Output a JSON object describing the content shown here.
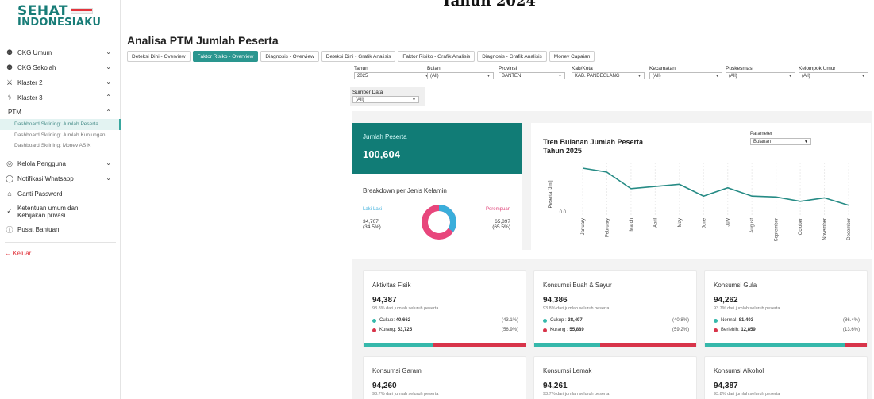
{
  "top_title": "Tahun 2024",
  "logo": {
    "line1": "SEHAT",
    "line2": "INDONESIAKU"
  },
  "sidebar": {
    "items": [
      {
        "label": "CKG Umum",
        "icon": "users-icon",
        "glyph": "⚉"
      },
      {
        "label": "CKG Sekolah",
        "icon": "users-icon",
        "glyph": "⚉"
      },
      {
        "label": "Klaster 2",
        "icon": "family-icon",
        "glyph": "⚔"
      },
      {
        "label": "Klaster 3",
        "icon": "medical-icon",
        "glyph": "⚕"
      }
    ],
    "ptm_label": "PTM",
    "sub_items": [
      {
        "label": "Dashboard Skrining: Jumlah Peserta",
        "active": true
      },
      {
        "label": "Dashboard Skrining: Jumlah Kunjungan",
        "active": false
      },
      {
        "label": "Dashboard Skrining: Monev ASIK",
        "active": false
      }
    ],
    "bottom_items": [
      {
        "label": "Kelola Pengguna",
        "glyph": "◎"
      },
      {
        "label": "Notifikasi Whatsapp",
        "glyph": "◯"
      },
      {
        "label": "Ganti Password",
        "glyph": "⌂"
      },
      {
        "label": "Ketentuan umum dan Kebijakan privasi",
        "glyph": "✓"
      },
      {
        "label": "Pusat Bantuan",
        "glyph": "ⓘ"
      }
    ],
    "logout": "← Keluar"
  },
  "header": {
    "title": "Analisa PTM Jumlah Peserta"
  },
  "tabs": [
    {
      "label": "Deteksi Dini - Overview",
      "active": false
    },
    {
      "label": "Faktor Risiko - Overview",
      "active": true
    },
    {
      "label": "Diagnosis - Overview",
      "active": false
    },
    {
      "label": "Deteksi Dini - Grafik Analisis",
      "active": false
    },
    {
      "label": "Faktor Risiko - Grafik Analisis",
      "active": false
    },
    {
      "label": "Diagnosis - Grafik Analisis",
      "active": false
    },
    {
      "label": "Monev Capaian",
      "active": false
    }
  ],
  "filters": {
    "tahun": {
      "label": "Tahun",
      "value": "2025"
    },
    "bulan": {
      "label": "Bulan",
      "value": "(All)"
    },
    "provinsi": {
      "label": "Provinsi",
      "value": "BANTEN"
    },
    "kabkota": {
      "label": "Kab/Kota",
      "value": "KAB. PANDEGLANG"
    },
    "kecamatan": {
      "label": "Kecamatan",
      "value": "(All)"
    },
    "puskesmas": {
      "label": "Puskesmas",
      "value": "(All)"
    },
    "kelompok_umur": {
      "label": "Kelompok Umur",
      "value": "(All)"
    },
    "sumber_data": {
      "label": "Sumber Data",
      "value": "(All)"
    }
  },
  "kpi": {
    "title": "Jumlah Peserta",
    "value": "100,604"
  },
  "breakdown": {
    "title": "Breakdown per Jenis Kelamin",
    "male_label": "Laki-Laki",
    "male_value": "34,707",
    "male_pct": "(34.5%)",
    "male_share": 0.345,
    "female_label": "Perempuan",
    "female_value": "65,897",
    "female_pct": "(65.5%)",
    "male_color": "#3aaedb",
    "female_color": "#e8467c"
  },
  "trend": {
    "title_line1": "Tren Bulanan Jumlah Peserta",
    "title_line2": "Tahun 2025",
    "param_label": "Parameter",
    "param_value": "Bulanan",
    "y_axis_label": "Peserta [Jml]",
    "y_tick": "0.0"
  },
  "chart_data": {
    "type": "line",
    "title": "Tren Bulanan Jumlah Peserta Tahun 2025",
    "ylabel": "Peserta [Jml]",
    "categories": [
      "January",
      "February",
      "March",
      "April",
      "May",
      "June",
      "July",
      "August",
      "September",
      "October",
      "November",
      "December"
    ],
    "values": [
      1.0,
      0.91,
      0.53,
      0.58,
      0.63,
      0.36,
      0.55,
      0.36,
      0.34,
      0.24,
      0.32,
      0.15
    ],
    "line_color": "#268b85"
  },
  "metrics": [
    {
      "title": "Aktivitas Fisik",
      "value": "94,387",
      "sub": "93.8% dari jumlah seluruh peserta",
      "r1_label": "Cukup:",
      "r1_value": "40,662",
      "r1_pct": "(43.1%)",
      "r1_share": 0.431,
      "r2_label": "Kurang:",
      "r2_value": "53,725",
      "r2_pct": "(56.9%)"
    },
    {
      "title": "Konsumsi Buah & Sayur",
      "value": "94,386",
      "sub": "93.8% dari jumlah seluruh peserta",
      "r1_label": "Cukup :",
      "r1_value": "38,497",
      "r1_pct": "(40.8%)",
      "r1_share": 0.408,
      "r2_label": "Kurang :",
      "r2_value": "55,889",
      "r2_pct": "(59.2%)"
    },
    {
      "title": "Konsumsi Gula",
      "value": "94,262",
      "sub": "93.7% dari jumlah seluruh peserta",
      "r1_label": "Normal:",
      "r1_value": "81,403",
      "r1_pct": "(86.4%)",
      "r1_share": 0.864,
      "r2_label": "Berlebih:",
      "r2_value": "12,859",
      "r2_pct": "(13.6%)"
    },
    {
      "title": "Konsumsi Garam",
      "value": "94,260",
      "sub": "93.7% dari jumlah seluruh peserta"
    },
    {
      "title": "Konsumsi Lemak",
      "value": "94,261",
      "sub": "93.7% dari jumlah seluruh peserta"
    },
    {
      "title": "Konsumsi Alkohol",
      "value": "94,387",
      "sub": "93.8% dari jumlah seluruh peserta"
    }
  ],
  "colors": {
    "good": "#36b8ab",
    "bad": "#d8344a",
    "brand": "#177c77"
  }
}
